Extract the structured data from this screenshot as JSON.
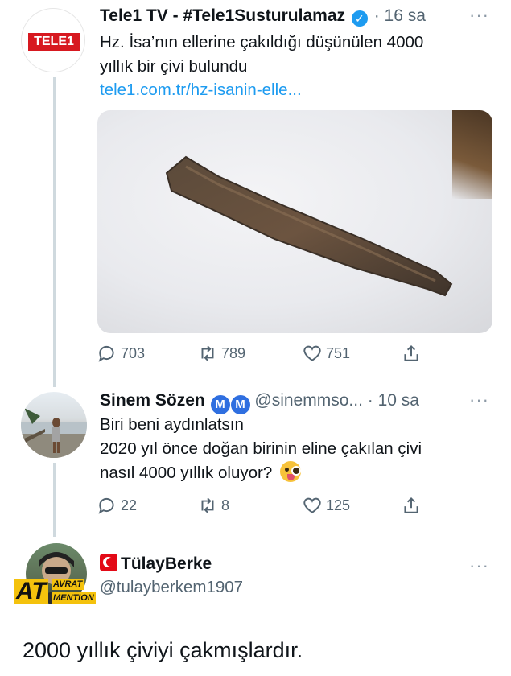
{
  "tweet1": {
    "avatar_text": "TELE1",
    "name": "Tele1 TV - #Tele1Susturulamaz",
    "dot": "·",
    "time": "16 sa",
    "more": "···",
    "text_line1": "Hz. İsa’nın ellerine çakıldığı düşünülen 4000",
    "text_line2": "yıllık bir çivi bulundu",
    "link": "tele1.com.tr/hz-isanin-elle...",
    "replies": "703",
    "retweets": "789",
    "likes": "751"
  },
  "tweet2": {
    "name": "Sinem Sözen",
    "badge1": "M",
    "badge2": "M",
    "handle": "@sinemmso...",
    "dot": "·",
    "time": "10 sa",
    "more": "···",
    "text_line1": "Biri beni aydınlatsın",
    "text_line2": "2020 yıl önce doğan birinin eline çakılan çivi",
    "text_line3": "nasıl 4000 yıllık oluyor?",
    "replies": "22",
    "retweets": "8",
    "likes": "125"
  },
  "tweet3": {
    "name": "TülayBerke",
    "handle": "@tulayberkem1907",
    "more": "···",
    "sticker_big": "AT",
    "sticker_top": "AVRAT",
    "sticker_bottom": "MENTION",
    "text": "2000 yıllık çiviyi çakmışlardır."
  },
  "colors": {
    "accent": "#1d9bf0",
    "secondary_text": "#536471",
    "tele1_red": "#d71920"
  },
  "icons": {
    "reply": "reply-icon",
    "retweet": "retweet-icon",
    "like": "heart-icon",
    "share": "share-icon"
  }
}
